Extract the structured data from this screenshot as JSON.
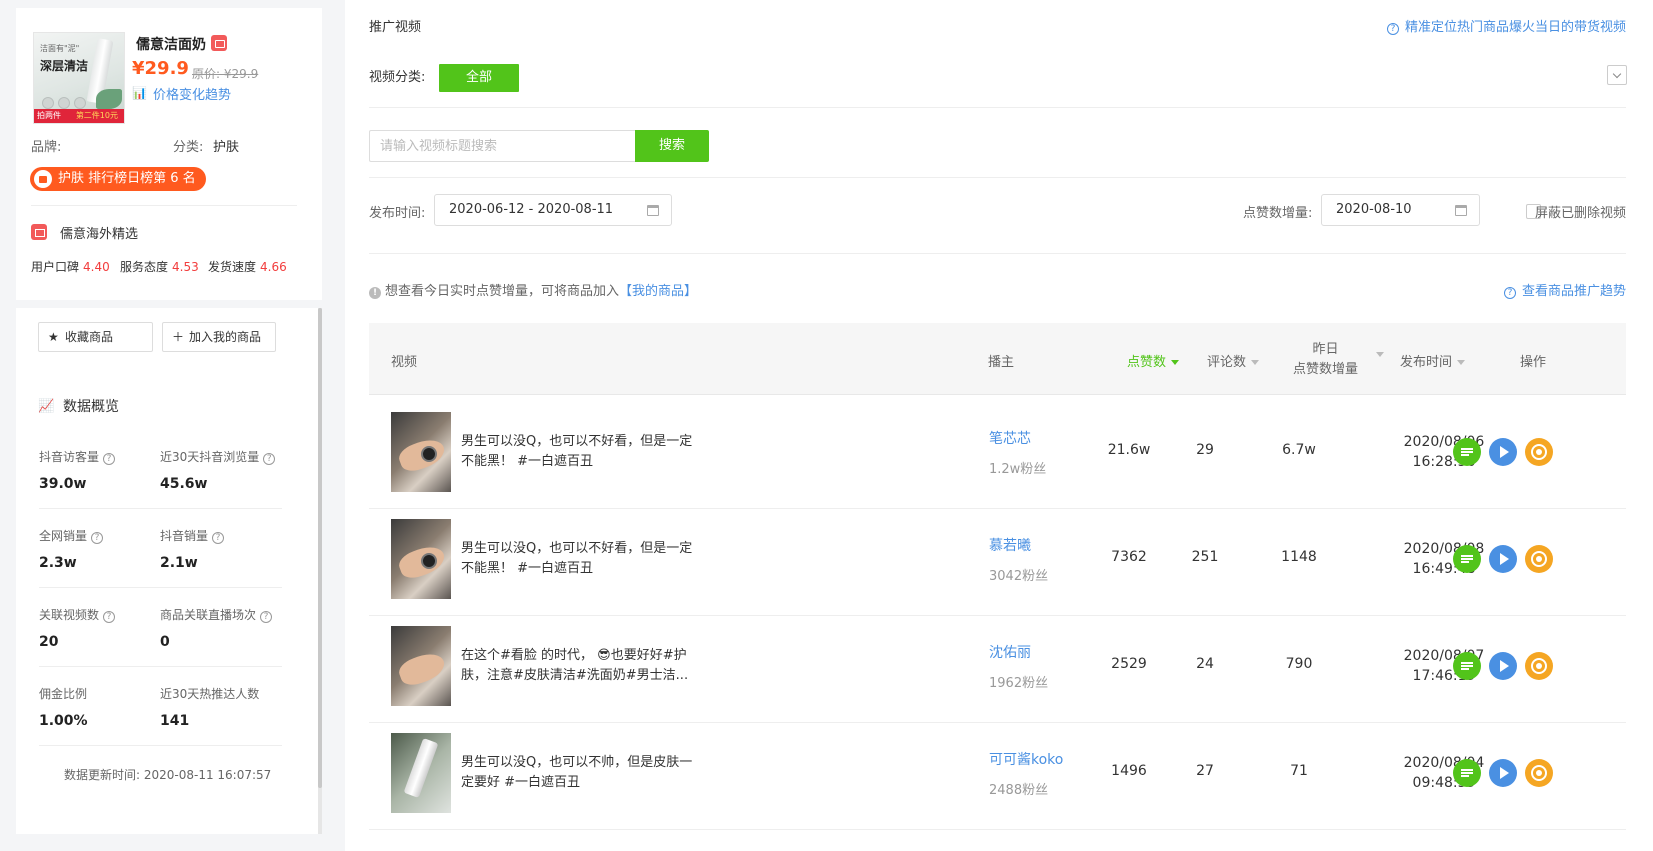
{
  "product": {
    "name": "儒意洁面奶",
    "price": "¥29.9",
    "original_price": "原价: ¥29.9",
    "price_trend_link": "价格变化趋势",
    "image_caption_top": "洁面有\"泥\"",
    "image_caption_main": "深层清洁",
    "image_band_left": "拍两件",
    "image_band_right": "第二件10元",
    "brand_label": "品牌:",
    "category_label": "分类:",
    "category_value": "护肤",
    "rank_badge": "护肤 排行榜日榜第 6 名"
  },
  "store": {
    "name": "儒意海外精选",
    "scores": [
      {
        "label": "用户口碑",
        "value": "4.40"
      },
      {
        "label": "服务态度",
        "value": "4.53"
      },
      {
        "label": "发货速度",
        "value": "4.66"
      }
    ]
  },
  "actions": {
    "favorite": "收藏商品",
    "add_mine": "加入我的商品"
  },
  "overview": {
    "title": "数据概览",
    "stats": [
      {
        "label": "抖音访客量",
        "value": "39.0w",
        "help": true
      },
      {
        "label": "近30天抖音浏览量",
        "value": "45.6w",
        "help": true
      },
      {
        "label": "全网销量",
        "value": "2.3w",
        "help": true
      },
      {
        "label": "抖音销量",
        "value": "2.1w",
        "help": true
      },
      {
        "label": "关联视频数",
        "value": "20",
        "help": true
      },
      {
        "label": "商品关联直播场次",
        "value": "0",
        "help": true
      },
      {
        "label": "佣金比例",
        "value": "1.00%",
        "help": false
      },
      {
        "label": "近30天热推达人数",
        "value": "141",
        "help": false
      }
    ],
    "update_time": "数据更新时间: 2020-08-11 16:07:57"
  },
  "main": {
    "section_title": "推广视频",
    "top_tip": "精准定位热门商品爆火当日的带货视频",
    "category_label": "视频分类:",
    "category_chip": "全部",
    "search_placeholder": "请输入视频标题搜索",
    "search_button": "搜索",
    "publish_time_label": "发布时间:",
    "publish_range": "2020-06-12 - 2020-08-11",
    "likes_inc_label": "点赞数增量:",
    "likes_inc_date": "2020-08-10",
    "hide_deleted": "屏蔽已删除视频",
    "info_text": "想查看今日实时点赞增量，可将商品加入",
    "info_link": "【我的商品】",
    "trend_link": "查看商品推广趋势"
  },
  "table": {
    "headers": {
      "video": "视频",
      "anchor": "播主",
      "likes": "点赞数",
      "comments": "评论数",
      "yesterday_1": "昨日",
      "yesterday_2": "点赞数增量",
      "publish": "发布时间",
      "ops": "操作"
    },
    "rows": [
      {
        "title": "男生可以没Q，也可以不好看，但是一定不能黑！ #一白遮百丑",
        "anchor": "笔芯芯",
        "fans": "1.2w粉丝",
        "likes": "21.6w",
        "comments": "29",
        "inc": "6.7w",
        "date": "2020/08/06",
        "time": "16:28:36"
      },
      {
        "title": "男生可以没Q，也可以不好看，但是一定不能黑！ #一白遮百丑",
        "anchor": "慕若曦",
        "fans": "3042粉丝",
        "likes": "7362",
        "comments": "251",
        "inc": "1148",
        "date": "2020/08/08",
        "time": "16:49:48"
      },
      {
        "title": "在这个#看脸 的时代， 😎也要好好#护肤，注意#皮肤清洁#洗面奶#男士洁...",
        "anchor": "沈佑丽",
        "fans": "1962粉丝",
        "likes": "2529",
        "comments": "24",
        "inc": "790",
        "date": "2020/08/07",
        "time": "17:46:19"
      },
      {
        "title": "男生可以没Q，也可以不帅，但是皮肤一定要好 #一白遮百丑",
        "anchor": "可可酱koko",
        "fans": "2488粉丝",
        "likes": "1496",
        "comments": "27",
        "inc": "71",
        "date": "2020/08/04",
        "time": "09:48:59"
      }
    ]
  }
}
